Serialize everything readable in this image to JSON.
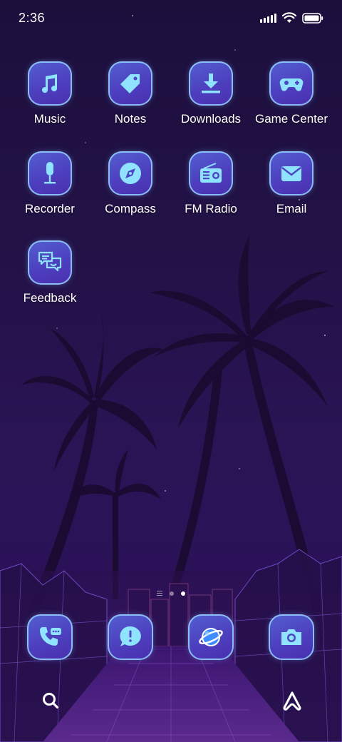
{
  "status_bar": {
    "time": "2:36",
    "signal_icon": "cellular-signal-icon",
    "wifi_icon": "wifi-icon",
    "battery_icon": "battery-icon"
  },
  "apps": [
    {
      "label": "Music",
      "icon": "music-note-icon"
    },
    {
      "label": "Notes",
      "icon": "tag-icon"
    },
    {
      "label": "Downloads",
      "icon": "download-icon"
    },
    {
      "label": "Game Center",
      "icon": "gamepad-icon"
    },
    {
      "label": "Recorder",
      "icon": "microphone-icon"
    },
    {
      "label": "Compass",
      "icon": "compass-icon"
    },
    {
      "label": "FM Radio",
      "icon": "radio-icon"
    },
    {
      "label": "Email",
      "icon": "envelope-icon"
    },
    {
      "label": "Feedback",
      "icon": "feedback-chat-icon"
    }
  ],
  "page_indicator": {
    "pages": 2,
    "current": 2,
    "has_app_list_marker": true
  },
  "dock": [
    {
      "icon": "phone-icon"
    },
    {
      "icon": "message-icon"
    },
    {
      "icon": "browser-planet-icon"
    },
    {
      "icon": "camera-icon"
    }
  ],
  "bottom_controls": [
    {
      "icon": "search-icon"
    },
    {
      "icon": "assistant-icon"
    }
  ],
  "colors": {
    "icon_glyph": "#8fe3ff",
    "icon_tile": "#4d46c4",
    "icon_border": "#96d2ff",
    "background": "#231247"
  }
}
